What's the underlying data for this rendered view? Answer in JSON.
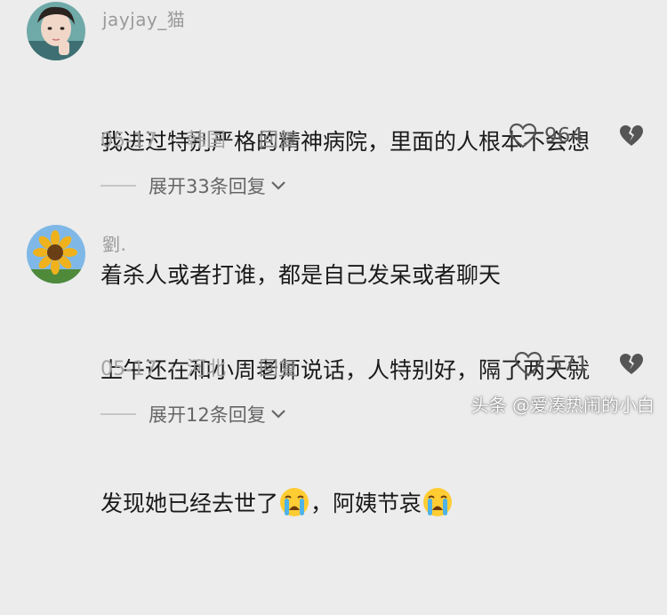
{
  "comments": [
    {
      "username": "jayjay_猫",
      "line1": "我进过特别严格的精神病院，里面的人根本不会想",
      "line2": "着杀人或者打谁，都是自己发呆或者聊天",
      "date": "05-17",
      "sep": "·",
      "location": "韩国",
      "reply_label": "回复",
      "likes": "964",
      "expand_label": "展开33条回复"
    },
    {
      "username": "劉.",
      "line1": "上午还在和小周老师说话，人特别好，隔了两天就",
      "line2_a": "发现她已经去世了",
      "line2_b": "，阿姨节哀",
      "date": "05-17",
      "sep": "·",
      "location": "河北",
      "reply_label": "回复",
      "likes": "571",
      "expand_label": "展开12条回复"
    }
  ],
  "watermark": "头条 @爱凑热闹的小白",
  "icons": {
    "like": "heart-outline-icon",
    "dislike": "broken-heart-icon",
    "expand": "chevron-down-icon",
    "emoji": "crying-face-emoji"
  }
}
